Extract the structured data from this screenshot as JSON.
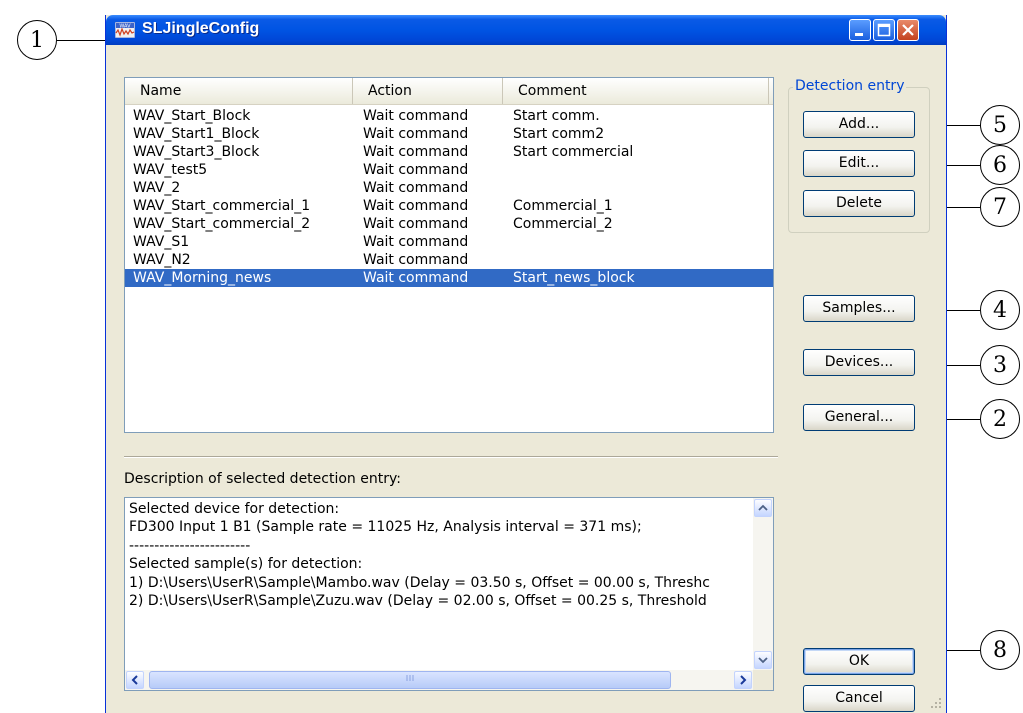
{
  "window": {
    "title": "SLJingleConfig",
    "icon_name": "wav-app-icon",
    "title_buttons": [
      "minimize-button",
      "maximize-button",
      "close-button"
    ]
  },
  "list": {
    "columns": [
      "Name",
      "Action",
      "Comment"
    ],
    "rows": [
      {
        "name": "WAV_Start_Block",
        "action": "Wait command",
        "comment": "Start comm."
      },
      {
        "name": "WAV_Start1_Block",
        "action": "Wait command",
        "comment": "Start comm2"
      },
      {
        "name": "WAV_Start3_Block",
        "action": "Wait command",
        "comment": "Start commercial"
      },
      {
        "name": "WAV_test5",
        "action": "Wait command",
        "comment": ""
      },
      {
        "name": "WAV_2",
        "action": "Wait command",
        "comment": ""
      },
      {
        "name": "WAV_Start_commercial_1",
        "action": "Wait command",
        "comment": "Commercial_1"
      },
      {
        "name": "WAV_Start_commercial_2",
        "action": "Wait command",
        "comment": "Commercial_2"
      },
      {
        "name": "WAV_S1",
        "action": "Wait command",
        "comment": ""
      },
      {
        "name": "WAV_N2",
        "action": "Wait command",
        "comment": ""
      },
      {
        "name": "WAV_Morning_news",
        "action": "Wait command",
        "comment": "Start_news_block",
        "selected": true
      }
    ]
  },
  "detection_group": {
    "title": "Detection entry",
    "add_label": "Add...",
    "edit_label": "Edit...",
    "delete_label": "Delete"
  },
  "side_buttons": {
    "samples_label": "Samples...",
    "devices_label": "Devices...",
    "general_label": "General..."
  },
  "description": {
    "label": "Description of selected detection entry:",
    "lines": [
      "Selected device for detection:",
      "FD300 Input 1 B1 (Sample rate = 11025 Hz, Analysis interval = 371 ms);",
      "------------------------",
      "Selected sample(s) for detection:",
      "1) D:\\Users\\UserR\\Sample\\Mambo.wav (Delay = 03.50 s, Offset = 00.00 s, Threshc",
      "2) D:\\Users\\UserR\\Sample\\Zuzu.wav (Delay = 02.00 s, Offset = 00.25 s, Threshold"
    ]
  },
  "footer": {
    "ok_label": "OK",
    "cancel_label": "Cancel"
  },
  "callouts": {
    "c1": "1",
    "c2": "2",
    "c3": "3",
    "c4": "4",
    "c5": "5",
    "c6": "6",
    "c7": "7",
    "c8": "8"
  },
  "colors": {
    "titlebar": "#0054e3",
    "selection": "#316ac5",
    "group_title": "#0046d5",
    "dialog_bg": "#ece9d8"
  }
}
